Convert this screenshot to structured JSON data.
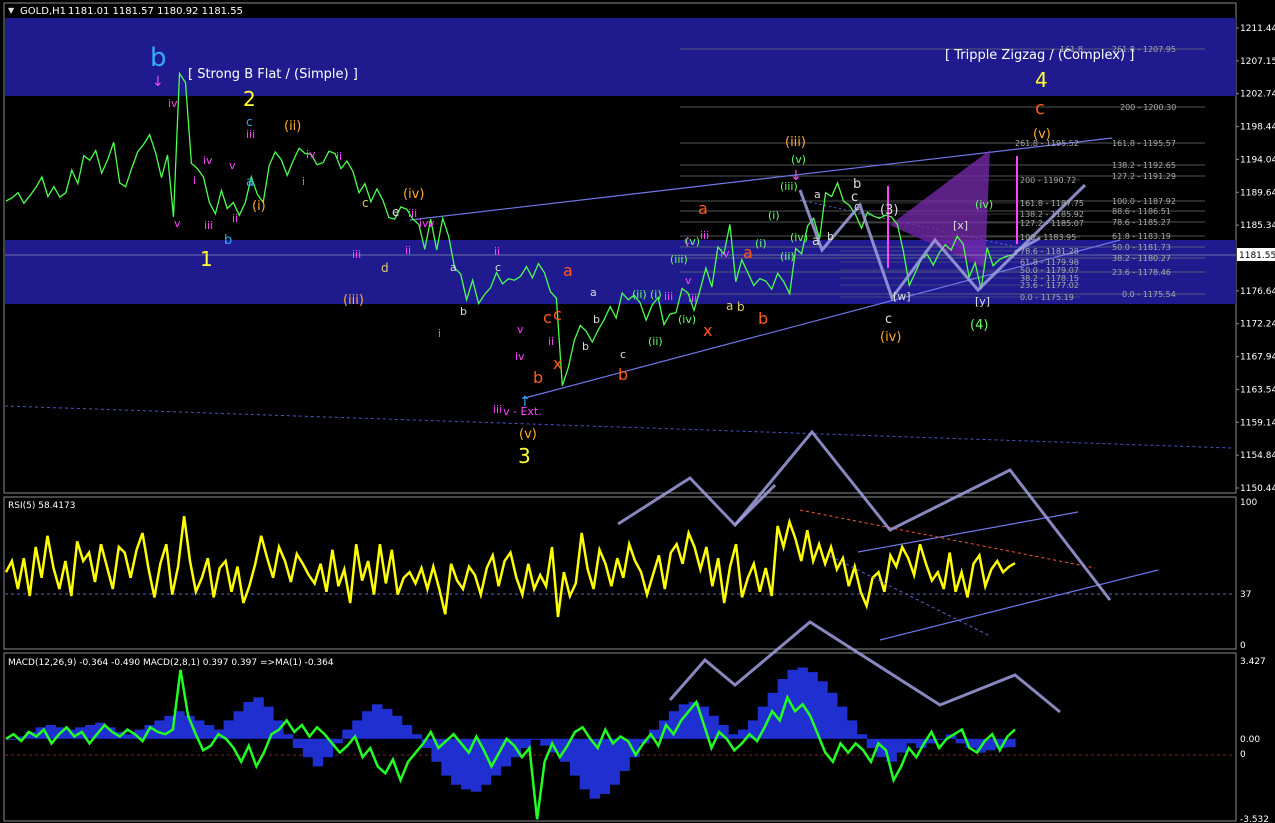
{
  "colors": {
    "background": "#000000",
    "band": "#1f1b8f",
    "border": "#8a8a8a",
    "price": "#4cff4c",
    "wick": "#ffffff",
    "rsi": "#ffff00",
    "macd_hist": "#1f2fd0",
    "macd_line": "#22ff22",
    "scenario": "#a0a0e0",
    "wave_yellow": "#ffff33",
    "wave_cyan": "#33aaff",
    "wave_magenta": "#ff44ff",
    "wave_orange": "#ffaa33",
    "wave_red": "#ff5a1e",
    "wave_green": "#66ff66",
    "wave_white": "#dddddd",
    "fib": "#9aa0a0",
    "text": "#ffffff"
  },
  "header": {
    "symbol": "GOLD,H1",
    "ohlc": "1181.01 1181.57 1180.92 1181.55"
  },
  "price_panel": {
    "ylim": [
      1150.44,
      1211.44
    ],
    "axis_ticks": [
      "1211.44",
      "1207.15",
      "1202.74",
      "1198.44",
      "1194.04",
      "1189.64",
      "1185.34",
      "1181.55",
      "1176.64",
      "1172.24",
      "1167.94",
      "1163.54",
      "1159.14",
      "1154.84",
      "1150.44"
    ],
    "current_price": "1181.55"
  },
  "annotations": {
    "strong_b_flat": "[ Strong B Flat / (Simple) ]",
    "triple_zigzag": "[ Tripple Zigzag / (Complex) ]",
    "v_ext": "v - Ext."
  },
  "wave_labels": [
    {
      "t": "b",
      "c": "wave_cyan",
      "s": 26
    },
    {
      "t": "2",
      "c": "wave_yellow",
      "s": 20
    },
    {
      "t": "1",
      "c": "wave_yellow",
      "s": 20
    },
    {
      "t": "3",
      "c": "wave_yellow",
      "s": 20
    },
    {
      "t": "4",
      "c": "wave_yellow",
      "s": 20
    },
    {
      "t": "c",
      "c": "wave_red",
      "s": 18
    },
    {
      "t": "(v)",
      "c": "wave_orange",
      "s": 13
    },
    {
      "t": "(ii)",
      "c": "wave_orange",
      "s": 13
    },
    {
      "t": "(iii)",
      "c": "wave_orange",
      "s": 13
    },
    {
      "t": "(iv)",
      "c": "wave_orange",
      "s": 13
    },
    {
      "t": "(iii)",
      "c": "wave_orange",
      "s": 13
    },
    {
      "t": "(iv)",
      "c": "wave_orange",
      "s": 13
    },
    {
      "t": "(v)",
      "c": "wave_orange",
      "s": 13
    },
    {
      "t": "(i)",
      "c": "wave_orange",
      "s": 13
    },
    {
      "t": "a",
      "c": "wave_red",
      "s": 16
    },
    {
      "t": "b",
      "c": "wave_red",
      "s": 16
    },
    {
      "t": "c",
      "c": "wave_red",
      "s": 16
    },
    {
      "t": "x",
      "c": "wave_red",
      "s": 16
    },
    {
      "t": "a",
      "c": "wave_red",
      "s": 16
    },
    {
      "t": "b",
      "c": "wave_red",
      "s": 16
    },
    {
      "t": "x",
      "c": "wave_red",
      "s": 16
    },
    {
      "t": "c",
      "c": "wave_red",
      "s": 16
    },
    {
      "t": "a",
      "c": "wave_red",
      "s": 16
    },
    {
      "t": "b",
      "c": "wave_red",
      "s": 16
    },
    {
      "t": "c",
      "c": "wave_cyan",
      "s": 12
    },
    {
      "t": "a",
      "c": "wave_cyan",
      "s": 13
    },
    {
      "t": "b",
      "c": "wave_cyan",
      "s": 13
    },
    {
      "t": "(3)",
      "c": "wave_white",
      "s": 13
    },
    {
      "t": "(4)",
      "c": "wave_green",
      "s": 13
    },
    {
      "t": "(v)",
      "c": "wave_green",
      "s": 11
    },
    {
      "t": "(iii)",
      "c": "wave_green",
      "s": 11
    },
    {
      "t": "(iv)",
      "c": "wave_green",
      "s": 11
    },
    {
      "t": "(i)",
      "c": "wave_green",
      "s": 11
    },
    {
      "t": "(ii)",
      "c": "wave_green",
      "s": 11
    },
    {
      "t": "(iii)",
      "c": "wave_green",
      "s": 11
    },
    {
      "t": "(iv)",
      "c": "wave_green",
      "s": 11
    },
    {
      "t": "(i)",
      "c": "wave_green",
      "s": 11
    },
    {
      "t": "(ii)",
      "c": "wave_green",
      "s": 11
    },
    {
      "t": "(i)",
      "c": "wave_green",
      "s": 11
    },
    {
      "t": "(ii)",
      "c": "wave_green",
      "s": 11
    },
    {
      "t": "(iv)",
      "c": "wave_green",
      "s": 11
    },
    {
      "t": "(v)",
      "c": "wave_green",
      "s": 11
    },
    {
      "t": "b",
      "c": "wave_white",
      "s": 13
    },
    {
      "t": "c",
      "c": "wave_white",
      "s": 13
    },
    {
      "t": "a",
      "c": "wave_white",
      "s": 13
    },
    {
      "t": "c",
      "c": "wave_white",
      "s": 13
    },
    {
      "t": "[w]",
      "c": "wave_white",
      "s": 11
    },
    {
      "t": "[x]",
      "c": "wave_white",
      "s": 11
    },
    {
      "t": "[y]",
      "c": "wave_white",
      "s": 11
    },
    {
      "t": "b",
      "c": "wave_white",
      "s": 11
    },
    {
      "t": "c",
      "c": "wave_white",
      "s": 11
    },
    {
      "t": "a",
      "c": "wave_white",
      "s": 11
    },
    {
      "t": "a",
      "c": "wave_white",
      "s": 11
    },
    {
      "t": "b",
      "c": "wave_white",
      "s": 11
    },
    {
      "t": "c",
      "c": "wave_white",
      "s": 11
    },
    {
      "t": "a",
      "c": "wave_white",
      "s": 11
    },
    {
      "t": "b",
      "c": "wave_white",
      "s": 11
    },
    {
      "t": "b",
      "c": "wave_white",
      "s": 11
    },
    {
      "t": "c",
      "c": "wave_white",
      "s": 11
    },
    {
      "t": "a",
      "c": "wave_yellowish",
      "s": 12
    },
    {
      "t": "b",
      "c": "wave_yellowish",
      "s": 12
    },
    {
      "t": "c",
      "c": "wave_yellowish",
      "s": 12
    },
    {
      "t": "d",
      "c": "wave_yellowish",
      "s": 12
    },
    {
      "t": "e",
      "c": "wave_white",
      "s": 12
    },
    {
      "t": "ii",
      "c": "wave_magenta",
      "s": 11
    },
    {
      "t": "iii",
      "c": "wave_magenta",
      "s": 11
    },
    {
      "t": "iv",
      "c": "wave_magenta",
      "s": 11
    },
    {
      "t": "v",
      "c": "wave_magenta",
      "s": 11
    },
    {
      "t": "i",
      "c": "wave_magenta",
      "s": 11
    },
    {
      "t": "iii",
      "c": "wave_magenta",
      "s": 11
    },
    {
      "t": "iv",
      "c": "wave_magenta",
      "s": 11
    },
    {
      "t": "v",
      "c": "wave_magenta",
      "s": 11
    },
    {
      "t": "ii",
      "c": "wave_magenta",
      "s": 11
    },
    {
      "t": "iii",
      "c": "wave_magenta",
      "s": 11
    },
    {
      "t": "iv",
      "c": "wave_magenta",
      "s": 11
    },
    {
      "t": "i",
      "c": "wave_magenta",
      "s": 11
    },
    {
      "t": "ii",
      "c": "wave_magenta",
      "s": 11
    },
    {
      "t": "iii",
      "c": "wave_magenta",
      "s": 11
    },
    {
      "t": "iv",
      "c": "wave_magenta",
      "s": 11
    },
    {
      "t": "v",
      "c": "wave_magenta",
      "s": 11
    },
    {
      "t": "i",
      "c": "wave_magenta",
      "s": 11
    },
    {
      "t": "ii",
      "c": "wave_magenta",
      "s": 11
    },
    {
      "t": "iii",
      "c": "wave_magenta",
      "s": 11
    },
    {
      "t": "iv",
      "c": "wave_magenta",
      "s": 11
    },
    {
      "t": "v",
      "c": "wave_magenta",
      "s": 11
    },
    {
      "t": "ii",
      "c": "wave_magenta",
      "s": 11
    },
    {
      "t": "iii",
      "c": "wave_magenta",
      "s": 11
    },
    {
      "t": "c",
      "c": "wave_magenta",
      "s": 11
    },
    {
      "t": "v",
      "c": "wave_magenta",
      "s": 11
    },
    {
      "t": "iii",
      "c": "wave_magenta",
      "s": 11
    },
    {
      "t": "iv",
      "c": "wave_magenta",
      "s": 11
    },
    {
      "t": "iii",
      "c": "wave_magenta",
      "s": 11
    }
  ],
  "fib_labels": [
    "261.8 - 1207.95",
    "200 - 1200.30",
    "161.8 - 1195.57",
    "138.2 - 1192.65",
    "127.2 - 1191.29",
    "100.0 - 1187.92",
    "88.6 - 1186.51",
    "78.6 - 1185.27",
    "61.8 - 1183.19",
    "50.0 - 1181.73",
    "38.2 - 1180.27",
    "23.6 - 1178.46",
    "0.0 - 1175.54",
    "261.8 - 1195.52",
    "200 - 1190.72",
    "161.8 - 1187.75",
    "138.2 - 1185.92",
    "127.2 - 1185.07",
    "100 - 1183.95",
    "78.6 - 1181.28",
    "61.8 - 1179.98",
    "50.0 - 1179.07",
    "38.2 - 1178.15",
    "23.6 - 1177.02",
    "0.0 - 1175.19",
    "161.8"
  ],
  "rsi_panel": {
    "label": "RSI(5) 58.4173",
    "ylim": [
      0,
      100
    ],
    "ticks": [
      "100",
      "37",
      "0"
    ]
  },
  "macd_panel": {
    "label": "MACD(12,26,9) -0.364 -0.490   MACD(2,8,1) 0.397 0.397   =>MA(1) -0.364",
    "ticks": [
      "3.427",
      "0.00",
      "0",
      "-3.532"
    ]
  },
  "chart_data": [
    {
      "type": "line",
      "name": "GOLD,H1",
      "ylim": [
        1150.44,
        1211.44
      ],
      "last_price": 1181.55,
      "y": [
        1188.5,
        1188.9,
        1189.6,
        1188.2,
        1189.2,
        1190.3,
        1191.7,
        1189.1,
        1190.4,
        1189.0,
        1189.6,
        1192.6,
        1190.8,
        1194.5,
        1193.9,
        1195.2,
        1192.2,
        1194.0,
        1196.3,
        1190.9,
        1190.4,
        1192.8,
        1195.0,
        1196.0,
        1197.3,
        1194.9,
        1191.6,
        1194.6,
        1186.4,
        1205.4,
        1204.2,
        1193.5,
        1192.8,
        1191.7,
        1188.3,
        1186.8,
        1189.9,
        1187.5,
        1188.3,
        1186.6,
        1188.3,
        1191.7,
        1189.4,
        1188.3,
        1193.2,
        1195.0,
        1194.0,
        1191.9,
        1193.8,
        1195.5,
        1194.8,
        1194.7,
        1193.3,
        1193.6,
        1195.1,
        1194.8,
        1192.8,
        1193.8,
        1192.4,
        1189.6,
        1190.8,
        1188.4,
        1190.1,
        1188.6,
        1186.3,
        1186.1,
        1187.7,
        1187.4,
        1186.1,
        1185.4,
        1182.1,
        1186.1,
        1182.0,
        1186.2,
        1183.8,
        1179.6,
        1178.8,
        1175.4,
        1178.0,
        1174.9,
        1176.1,
        1177.0,
        1179.0,
        1177.5,
        1178.2,
        1178.0,
        1178.5,
        1179.8,
        1178.3,
        1180.2,
        1179.0,
        1176.5,
        1175.6,
        1164.0,
        1166.4,
        1170.0,
        1172.0,
        1171.2,
        1169.8,
        1171.4,
        1172.8,
        1174.5,
        1173.0,
        1176.3,
        1175.4,
        1176.0,
        1175.0,
        1172.7,
        1174.7,
        1175.7,
        1172.1,
        1173.5,
        1173.7,
        1176.9,
        1176.3,
        1174.0,
        1176.6,
        1179.6,
        1177.1,
        1182.4,
        1181.5,
        1185.4,
        1177.8,
        1180.7,
        1179.0,
        1177.3,
        1178.2,
        1177.9,
        1176.8,
        1178.9,
        1177.8,
        1176.2,
        1182.2,
        1181.5,
        1185.2,
        1186.2,
        1183.5,
        1189.6,
        1189.1,
        1190.9,
        1188.5,
        1187.9,
        1186.7,
        1184.9,
        1187.0,
        1186.5,
        1186.2,
        1186.6,
        1186.4,
        1185.4,
        1181.9,
        1177.3,
        1179.0,
        1180.8,
        1181.4,
        1180.0,
        1181.6,
        1182.7,
        1182.0,
        1183.8,
        1182.8,
        1178.4,
        1180.3,
        1176.8,
        1182.3,
        1179.9,
        1180.7,
        1181.1,
        1181.3,
        1181.55
      ]
    },
    {
      "type": "line",
      "name": "RSI(5)",
      "ylim": [
        0,
        100
      ],
      "reference_level": 37,
      "last": 58.4173,
      "y": [
        52,
        60,
        40,
        62,
        35,
        70,
        48,
        78,
        55,
        40,
        60,
        35,
        74,
        60,
        66,
        45,
        72,
        56,
        40,
        70,
        66,
        48,
        68,
        80,
        55,
        34,
        58,
        72,
        36,
        56,
        92,
        60,
        38,
        48,
        62,
        34,
        55,
        60,
        38,
        56,
        30,
        42,
        58,
        78,
        62,
        48,
        70,
        60,
        45,
        65,
        58,
        50,
        44,
        58,
        38,
        68,
        42,
        54,
        30,
        72,
        46,
        60,
        36,
        72,
        44,
        68,
        36,
        48,
        52,
        44,
        55,
        40,
        56,
        40,
        22,
        58,
        46,
        40,
        56,
        50,
        36,
        55,
        64,
        42,
        60,
        66,
        48,
        36,
        58,
        40,
        50,
        42,
        70,
        20,
        52,
        35,
        44,
        80,
        54,
        40,
        68,
        58,
        42,
        62,
        48,
        72,
        60,
        52,
        36,
        50,
        64,
        40,
        66,
        72,
        58,
        80,
        70,
        54,
        70,
        42,
        62,
        30,
        56,
        72,
        34,
        48,
        58,
        38,
        55,
        35,
        85,
        70,
        88,
        76,
        60,
        82,
        60,
        72,
        58,
        70,
        54,
        62,
        42,
        56,
        38,
        28,
        48,
        52,
        38,
        64,
        56,
        70,
        62,
        50,
        72,
        58,
        46,
        52,
        40,
        66,
        38,
        52,
        34,
        58,
        64,
        42,
        54,
        60,
        52,
        56,
        58.4
      ]
    },
    {
      "type": "line",
      "name": "MACD(2,8,1)",
      "ylim": [
        -3.532,
        3.427
      ],
      "last": 0.397,
      "y": [
        0.0,
        0.2,
        -0.1,
        0.3,
        0.1,
        0.4,
        -0.2,
        0.2,
        0.5,
        0.1,
        0.3,
        -0.2,
        0.2,
        0.6,
        0.3,
        0.1,
        0.4,
        0.2,
        -0.1,
        0.5,
        0.3,
        0.2,
        0.4,
        3.0,
        1.0,
        0.2,
        -0.5,
        -0.3,
        0.2,
        0.0,
        -0.4,
        -1.0,
        -0.3,
        -1.2,
        -0.6,
        0.2,
        0.4,
        0.8,
        0.3,
        0.6,
        0.1,
        0.5,
        0.2,
        -0.2,
        -0.6,
        -0.3,
        0.1,
        -0.8,
        -0.4,
        -1.2,
        -1.5,
        -0.9,
        -1.8,
        -1.0,
        -0.6,
        -0.2,
        0.3,
        -0.4,
        -0.1,
        0.2,
        -0.2,
        -0.6,
        0.1,
        -0.5,
        -1.2,
        -0.6,
        0.0,
        -0.3,
        -0.8,
        -0.4,
        -3.5,
        -1.0,
        -0.2,
        -0.8,
        -0.3,
        0.3,
        0.5,
        0.0,
        -0.4,
        0.4,
        -0.2,
        0.1,
        -0.1,
        -0.7,
        -0.2,
        0.2,
        -0.3,
        0.6,
        0.2,
        0.8,
        1.2,
        1.6,
        0.6,
        -0.4,
        0.3,
        0.0,
        -0.5,
        -0.2,
        0.2,
        -0.1,
        0.5,
        1.2,
        0.8,
        1.8,
        1.2,
        1.5,
        1.0,
        0.2,
        -0.6,
        -1.0,
        -0.2,
        -0.6,
        -0.2,
        -0.5,
        -1.0,
        -0.2,
        -0.5,
        -1.8,
        -1.2,
        -0.4,
        -0.8,
        -0.2,
        0.3,
        -0.4,
        0.0,
        0.2,
        0.4,
        -0.4,
        -0.6,
        -0.1,
        0.2,
        -0.5,
        0.1,
        0.4
      ]
    },
    {
      "type": "bar",
      "name": "MACD(12,26,9)",
      "ylim": [
        -3.532,
        3.427
      ],
      "last": -0.364,
      "values": [
        0.0,
        0.1,
        0.3,
        0.5,
        0.6,
        0.5,
        0.4,
        0.5,
        0.6,
        0.7,
        0.5,
        0.3,
        0.2,
        0.4,
        0.6,
        0.8,
        1.0,
        1.2,
        1.0,
        0.8,
        0.6,
        0.4,
        0.8,
        1.2,
        1.6,
        1.8,
        1.4,
        0.8,
        0.2,
        -0.4,
        -0.8,
        -1.2,
        -0.8,
        -0.2,
        0.4,
        0.8,
        1.2,
        1.5,
        1.3,
        1.0,
        0.6,
        0.2,
        -0.4,
        -1.0,
        -1.6,
        -2.0,
        -2.2,
        -2.3,
        -2.0,
        -1.6,
        -1.2,
        -0.8,
        -0.4,
        0.0,
        -0.3,
        -0.6,
        -1.0,
        -1.6,
        -2.2,
        -2.6,
        -2.4,
        -2.0,
        -1.4,
        -0.8,
        -0.2,
        0.4,
        0.8,
        1.2,
        1.5,
        1.6,
        1.4,
        1.0,
        0.6,
        0.2,
        0.4,
        0.8,
        1.4,
        2.0,
        2.6,
        3.0,
        3.1,
        2.9,
        2.5,
        2.0,
        1.4,
        0.8,
        0.2,
        -0.4,
        -0.8,
        -1.0,
        -0.6,
        -0.2,
        -0.4,
        -0.2,
        0.0,
        0.2,
        -0.2,
        -0.4,
        -0.6,
        -0.5,
        -0.4,
        -0.364
      ]
    }
  ]
}
